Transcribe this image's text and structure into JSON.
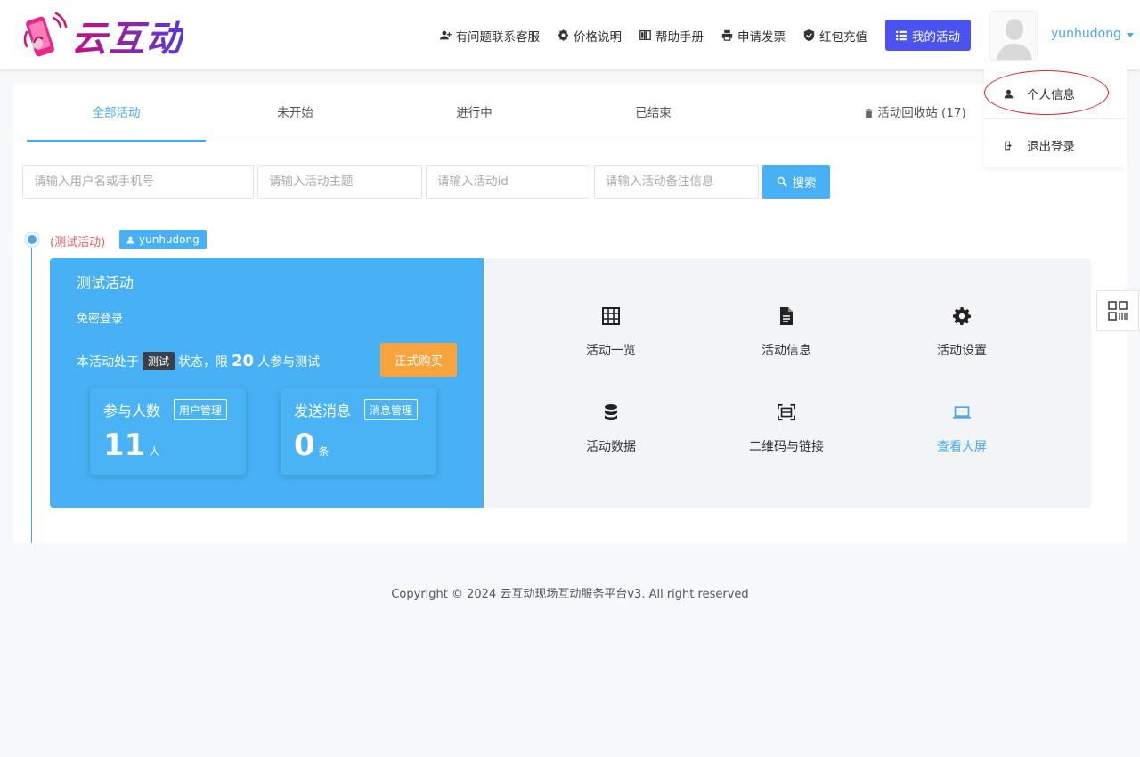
{
  "brand": {
    "name": "云互动"
  },
  "nav": {
    "items": [
      {
        "label": "有问题联系客服",
        "icon": "user-plus-icon"
      },
      {
        "label": "价格说明",
        "icon": "badge-icon"
      },
      {
        "label": "帮助手册",
        "icon": "book-icon"
      },
      {
        "label": "申请发票",
        "icon": "printer-icon"
      },
      {
        "label": "红包充值",
        "icon": "shield-check-icon"
      }
    ],
    "my_activities": "我的活动"
  },
  "user": {
    "name": "yunhudong"
  },
  "dropdown": {
    "profile": "个人信息",
    "logout": "退出登录"
  },
  "tabs": [
    {
      "label": "全部活动",
      "active": true
    },
    {
      "label": "未开始"
    },
    {
      "label": "进行中"
    },
    {
      "label": "已结束"
    },
    {
      "label": "活动回收站 (17)"
    }
  ],
  "search": {
    "user_placeholder": "请输入用户名或手机号",
    "subject_placeholder": "请输入活动主题",
    "id_placeholder": "请输入活动id",
    "note_placeholder": "请输入活动备注信息",
    "button": "搜索"
  },
  "activity": {
    "timeline_title": "(测试活动)",
    "owner": "yunhudong",
    "title": "测试活动",
    "login_mode": "免密登录",
    "status_prefix": "本活动处于",
    "status_tag": "测试",
    "status_mid": "状态，限",
    "limit": "20",
    "status_suffix": "人参与测试",
    "buy_button": "正式购买",
    "participants": {
      "label": "参与人数",
      "manage": "用户管理",
      "value": "11",
      "unit": "人"
    },
    "messages": {
      "label": "发送消息",
      "manage": "消息管理",
      "value": "0",
      "unit": "条"
    },
    "actions": [
      {
        "label": "活动一览",
        "icon": "grid-icon"
      },
      {
        "label": "活动信息",
        "icon": "document-icon"
      },
      {
        "label": "活动设置",
        "icon": "gear-icon"
      },
      {
        "label": "活动数据",
        "icon": "database-icon"
      },
      {
        "label": "二维码与链接",
        "icon": "scan-icon"
      },
      {
        "label": "查看大屏",
        "icon": "laptop-icon"
      }
    ]
  },
  "footer": {
    "text": "Copyright © 2024 云互动现场互动服务平台v3. All right reserved"
  },
  "colors": {
    "accent": "#48a8f0",
    "primary_button": "#4b52f0",
    "buy": "#f8a33c",
    "card": "#48b0f4"
  }
}
